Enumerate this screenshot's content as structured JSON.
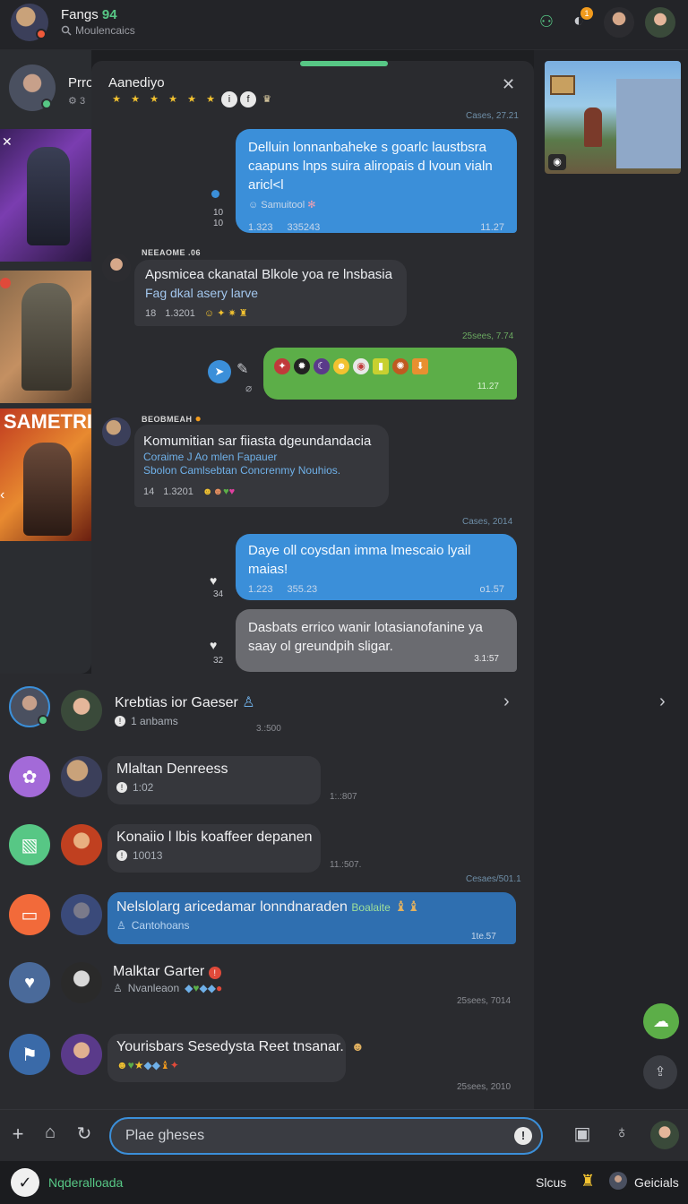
{
  "header": {
    "title": "Fangs",
    "title_badge": "94",
    "subtitle": "Moulencaics",
    "notif_count": "1",
    "icons": [
      "game-controller-icon",
      "notifications-icon"
    ]
  },
  "left_panel": {
    "contact_name": "Prro",
    "contact_sub": "3",
    "thumbs": [
      {
        "label": ""
      },
      {
        "label": ""
      },
      {
        "label": "SAMETRI"
      }
    ]
  },
  "chat": {
    "title": "Aanediyo",
    "messages": [
      {
        "stamp": "Cases, 27.21",
        "text": "Delluin lonnanbaheke s goarlc laustbsra caapuns lnps suira aliropais d lvoun vialn aricl<l",
        "sub": "Samuitool",
        "meta_left": "1.323",
        "meta_mid": "335243",
        "meta_right": "11.27",
        "side_a": "10",
        "side_b": "10"
      },
      {
        "sender": "NEEAOME .06",
        "text": "Apsmicea  ckanatal Blkole yoa re lnsbasia",
        "sub": "Fag dkal asery larve",
        "meta_left": "18",
        "meta_mid": "1.3201"
      },
      {
        "stamp": "25sees, 7.74",
        "meta_right": "11.27"
      },
      {
        "sender": "BEOBMEAH",
        "text": "Komumitian sar fiiasta dgeundandacia",
        "sub1": "Coraime J Ao mlen Fapauer",
        "sub2": "Sbolon Camlsebtan Concrenmy Nouhios.",
        "meta_left": "14",
        "meta_mid": "1.3201"
      },
      {
        "stamp": "Cases, 2014",
        "text": "Daye oll coysdan imma lmescaio lyail maias!",
        "meta_left": "1.223",
        "meta_mid": "355.23",
        "meta_right": "o1.57",
        "side": "34"
      },
      {
        "text": "Dasbats errico wanir lotasianofanine ya saay ol greundpih sligar.",
        "meta_right": "3.1:57",
        "side": "32"
      }
    ]
  },
  "list": [
    {
      "title": "Krebtias ior Gaeser",
      "sub": "1 anbams",
      "time": "3.:500"
    },
    {
      "title": "Mlaltan Denreess",
      "sub": "1:02",
      "time": "1:.:807"
    },
    {
      "title": "Konaiio l lbis koaffeer depanen",
      "sub": "10013",
      "time": "11.:507."
    },
    {
      "stamp": "Cesaes/501.1",
      "title": "Nelslolarg aricedamar lonndnaraden",
      "tag": "Boalaite",
      "sub": "Cantohoans",
      "time": "1te.57"
    },
    {
      "title": "Malktar Garter",
      "sub": "Nvanleaon",
      "time": "25sees, 7014"
    },
    {
      "title": "Yourisbars Sesedysta Reet tnsanar.",
      "sub": "",
      "time": "25sees, 2010"
    }
  ],
  "composer": {
    "placeholder": "Plae gheses"
  },
  "bottombar": {
    "left_label": "Nqderalloada",
    "mid_label": "Slcus",
    "right_label": "Geicials"
  },
  "colors": {
    "accent_green": "#57c785",
    "bubble_blue": "#3b8fd9",
    "bubble_green": "#5cae48",
    "background": "#1e1f22"
  }
}
